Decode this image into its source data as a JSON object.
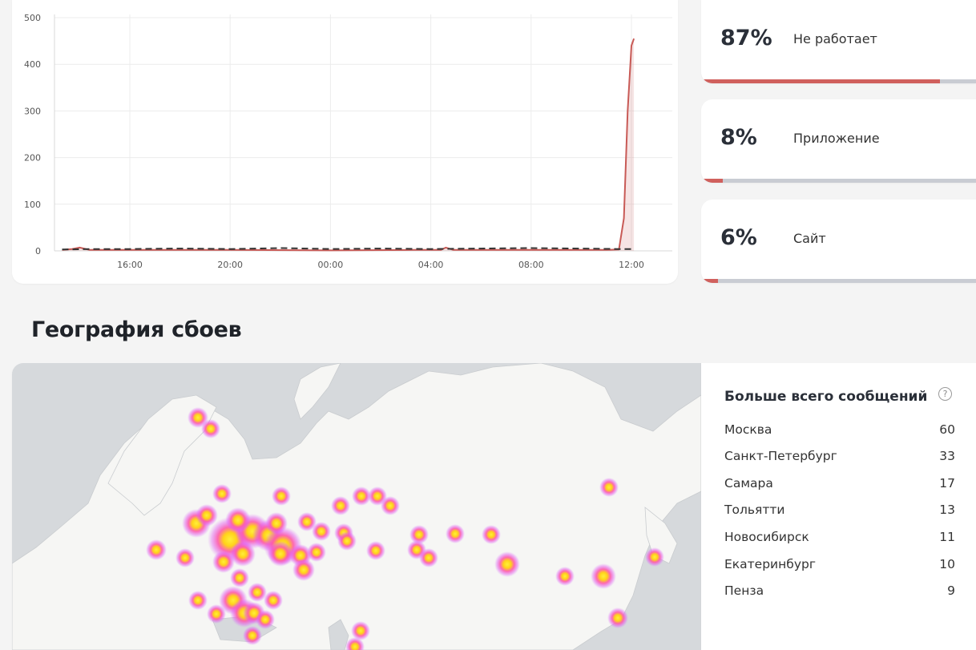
{
  "chart_data": {
    "type": "line",
    "y_ticks": [
      "0",
      "100",
      "200",
      "300",
      "400",
      "500"
    ],
    "x_ticks": [
      "16:00",
      "20:00",
      "00:00",
      "04:00",
      "08:00",
      "12:00"
    ],
    "ylim": [
      0,
      500
    ],
    "grid": true,
    "series": [
      {
        "style": "solid-filled",
        "color": "#c85a56",
        "points": [
          [
            13.3,
            2
          ],
          [
            13.7,
            4
          ],
          [
            14.0,
            7
          ],
          [
            14.4,
            2
          ],
          [
            15.0,
            2
          ],
          [
            20.0,
            2
          ],
          [
            24.0,
            1
          ],
          [
            27.3,
            2
          ],
          [
            28.4,
            2
          ],
          [
            28.6,
            7
          ],
          [
            28.9,
            2
          ],
          [
            32.0,
            2
          ],
          [
            35.0,
            2
          ],
          [
            35.5,
            3
          ],
          [
            35.7,
            70
          ],
          [
            35.85,
            300
          ],
          [
            36.0,
            440
          ],
          [
            36.1,
            455
          ]
        ]
      },
      {
        "style": "dashed",
        "color": "#333333",
        "points": [
          [
            13.3,
            3
          ],
          [
            14.5,
            4
          ],
          [
            16.0,
            4
          ],
          [
            18.0,
            5
          ],
          [
            20.0,
            4
          ],
          [
            22.0,
            6
          ],
          [
            24.0,
            4
          ],
          [
            26.0,
            5
          ],
          [
            28.0,
            4
          ],
          [
            30.0,
            5
          ],
          [
            32.0,
            6
          ],
          [
            34.0,
            5
          ],
          [
            35.5,
            4
          ],
          [
            36.0,
            4
          ]
        ]
      }
    ]
  },
  "stats": [
    {
      "percent": "87%",
      "label": "Не работает",
      "fill": 0.87
    },
    {
      "percent": "8%",
      "label": "Приложение",
      "fill": 0.08
    },
    {
      "percent": "6%",
      "label": "Сайт",
      "fill": 0.06
    }
  ],
  "section_title": "География сбоев",
  "cities_panel": {
    "title": "Больше всего сообщений",
    "help_glyph": "?",
    "cities": [
      {
        "name": "Москва",
        "count": "60"
      },
      {
        "name": "Санкт-Петербург",
        "count": "33"
      },
      {
        "name": "Самара",
        "count": "17"
      },
      {
        "name": "Тольятти",
        "count": "13"
      },
      {
        "name": "Новосибирск",
        "count": "11"
      },
      {
        "name": "Екатеринбург",
        "count": "10"
      },
      {
        "name": "Пенза",
        "count": "9"
      }
    ]
  },
  "colors": {
    "accent": "#d0605d",
    "bar_track": "#c9ccd3",
    "map_water": "#d6d9dc",
    "map_land": "#f6f6f4"
  }
}
